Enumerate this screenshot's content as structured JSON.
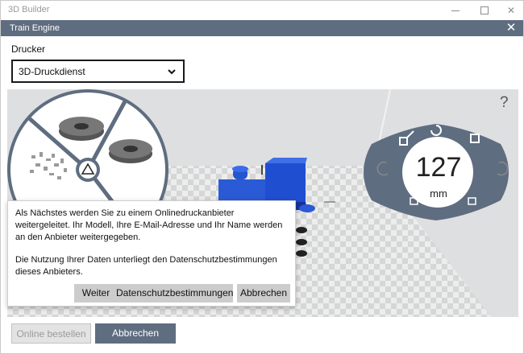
{
  "window": {
    "app_title": "3D Builder",
    "controls": {
      "minimize": "minimize-icon",
      "maximize": "maximize-icon",
      "close": "close-icon"
    }
  },
  "dialog": {
    "title": "Train Engine",
    "close_icon": "close-icon",
    "header_color": "#5f6d80"
  },
  "printer": {
    "label": "Drucker",
    "selected": "3D-Druckdienst"
  },
  "viewport": {
    "help_label": "?",
    "readout": {
      "value": "127",
      "unit": "mm"
    },
    "right_controls_icons": [
      "move-icon",
      "rotate-icon",
      "scale-icon",
      "undo-icon",
      "redo-icon",
      "settle-icon",
      "more-icon",
      "copy-icon"
    ],
    "more_label": "..."
  },
  "popup": {
    "text1": "Als Nächstes werden Sie zu einem Onlinedruckanbieter weitergeleitet. Ihr Modell, Ihre E-Mail-Adresse und Ihr Name werden an den Anbieter weitergegeben.",
    "text2": "Die Nutzung Ihrer Daten unterliegt den Datenschutzbestimmungen dieses Anbieters.",
    "buttons": {
      "next": "Weiter",
      "privacy": "Datenschutzbestimmungen",
      "cancel": "Abbrechen"
    }
  },
  "footer": {
    "order_label": "Online bestellen",
    "cancel_label": "Abbrechen"
  }
}
